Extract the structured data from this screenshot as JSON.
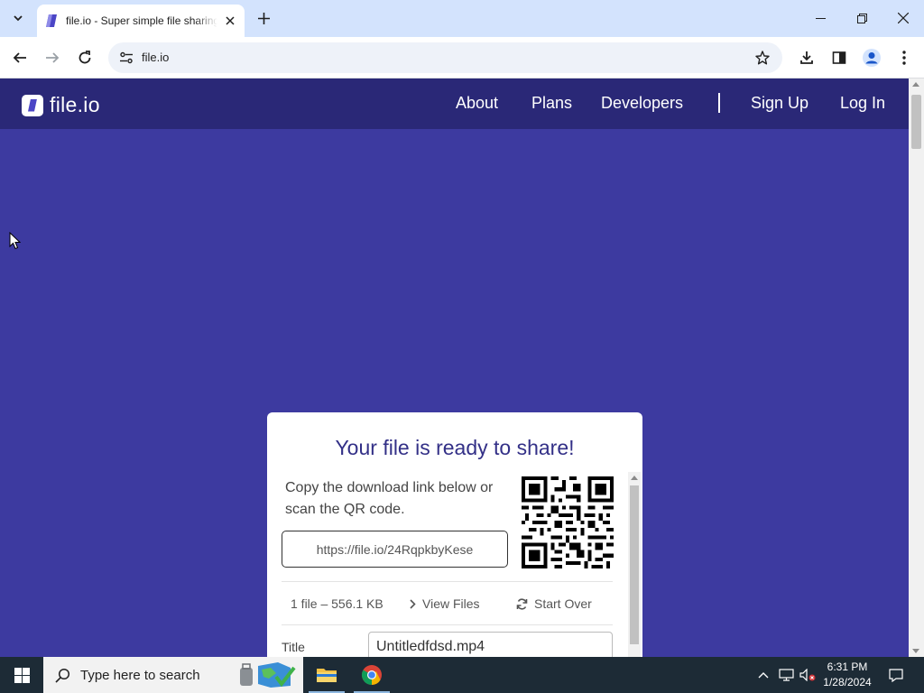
{
  "browser": {
    "tab_title": "file.io - Super simple file sharing",
    "address": "file.io"
  },
  "site": {
    "logo_text": "file.io",
    "nav": [
      "About",
      "Plans",
      "Developers",
      "Sign Up",
      "Log In"
    ]
  },
  "card": {
    "heading": "Your file is ready to share!",
    "description": "Copy the download link below or scan the QR code.",
    "link": "https://file.io/24RqpkbyKese",
    "file_info": "1 file – 556.1 KB",
    "view_files": "View Files",
    "start_over": "Start Over",
    "title_label": "Title",
    "title_value": "Untitledfdsd.mp4"
  },
  "taskbar": {
    "search_placeholder": "Type here to search",
    "time": "6:31 PM",
    "date": "1/28/2024"
  },
  "colors": {
    "page_bg": "#3d3aa0",
    "header_bg": "#2a2877",
    "heading": "#333087",
    "tabstrip": "#d3e3fd"
  }
}
